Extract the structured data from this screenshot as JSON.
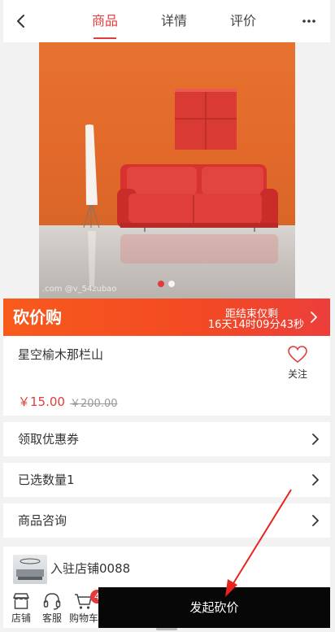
{
  "header": {
    "tabs": [
      {
        "label": "商品",
        "active": true
      },
      {
        "label": "详情",
        "active": false
      },
      {
        "label": "评价",
        "active": false
      }
    ],
    "more_icon": "ellipsis-icon",
    "back_icon": "chevron-left-icon"
  },
  "hero": {
    "watermark": ".com  @v_54zubao",
    "slide_count": 2,
    "current_slide": 1
  },
  "banner": {
    "title": "砍价购",
    "countdown_label": "距结束仅剩",
    "countdown": "16天14时09分43秒"
  },
  "product": {
    "name": "星空榆木那栏山",
    "follow_label": "关注",
    "price": "￥15.00",
    "original_price": "￥200.00"
  },
  "rows": [
    {
      "label": "领取优惠券"
    },
    {
      "label": "已选数量1"
    },
    {
      "label": "商品咨询"
    }
  ],
  "store": {
    "name": "入驻店铺0088"
  },
  "bottombar": {
    "store_label": "店铺",
    "service_label": "客服",
    "cart_label": "购物车",
    "cart_count": "4",
    "cta_label": "发起砍价"
  },
  "colors": {
    "accent": "#e23b3b",
    "banner_start": "#f85a1c",
    "banner_end": "#ec3e3b",
    "cta_bg": "#070707"
  }
}
